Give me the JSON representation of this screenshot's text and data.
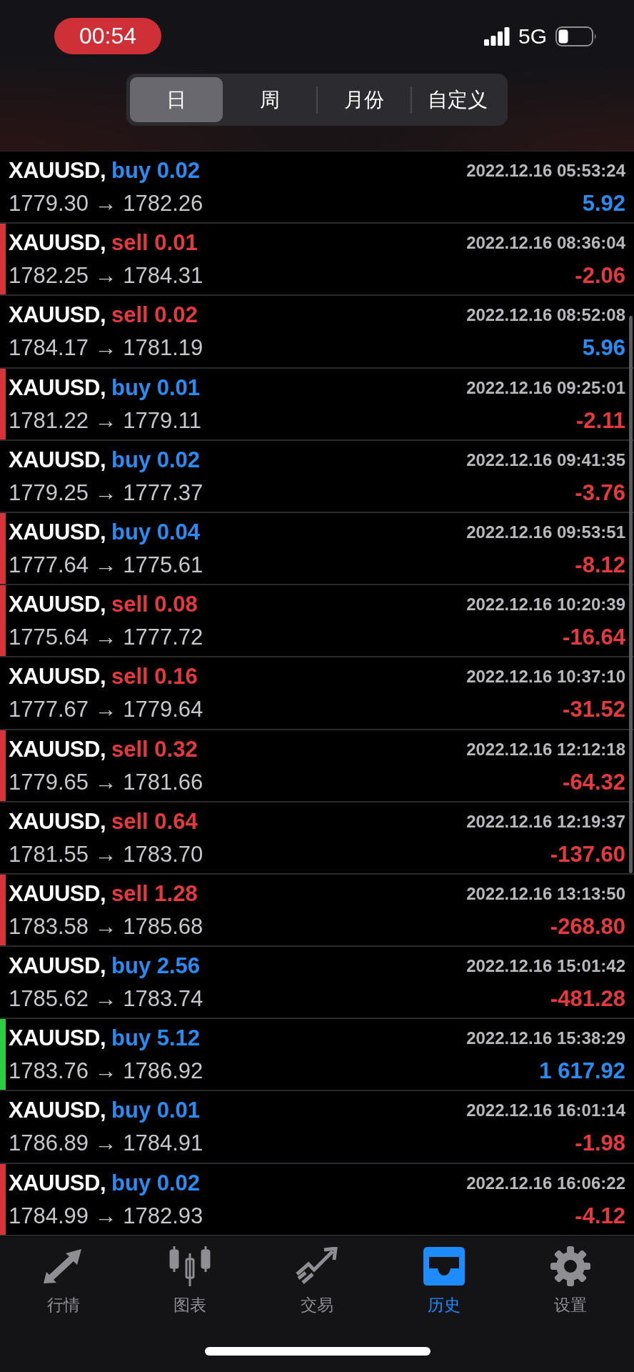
{
  "status_bar": {
    "time": "00:54",
    "network": "5G"
  },
  "period_tabs": [
    {
      "label": "日",
      "selected": true
    },
    {
      "label": "周",
      "selected": false
    },
    {
      "label": "月份",
      "selected": false
    },
    {
      "label": "自定义",
      "selected": false
    }
  ],
  "deals": [
    {
      "symbol": "XAUUSD,",
      "order": "buy 0.02",
      "kind": "buy",
      "time": "2022.12.16 05:53:24",
      "prices": "1779.30 → 1782.26",
      "profit": "5.92",
      "loss": false
    },
    {
      "symbol": "XAUUSD,",
      "order": "sell 0.01",
      "kind": "sell",
      "time": "2022.12.16 08:36:04",
      "prices": "1782.25 → 1784.31",
      "profit": "-2.06",
      "loss": true,
      "color": "#d8333a"
    },
    {
      "symbol": "XAUUSD,",
      "order": "sell 0.02",
      "kind": "sell",
      "time": "2022.12.16 08:52:08",
      "prices": "1784.17 → 1781.19",
      "profit": "5.96",
      "loss": false
    },
    {
      "symbol": "XAUUSD,",
      "order": "buy 0.01",
      "kind": "buy",
      "time": "2022.12.16 09:25:01",
      "prices": "1781.22 → 1779.11",
      "profit": "-2.11",
      "loss": true,
      "color": "#d8333a"
    },
    {
      "symbol": "XAUUSD,",
      "order": "buy 0.02",
      "kind": "buy",
      "time": "2022.12.16 09:41:35",
      "prices": "1779.25 → 1777.37",
      "profit": "-3.76",
      "loss": true
    },
    {
      "symbol": "XAUUSD,",
      "order": "buy 0.04",
      "kind": "buy",
      "time": "2022.12.16 09:53:51",
      "prices": "1777.64 → 1775.61",
      "profit": "-8.12",
      "loss": true,
      "color": "#d8333a"
    },
    {
      "symbol": "XAUUSD,",
      "order": "sell 0.08",
      "kind": "sell",
      "time": "2022.12.16 10:20:39",
      "prices": "1775.64 → 1777.72",
      "profit": "-16.64",
      "loss": true,
      "color": "#d8333a"
    },
    {
      "symbol": "XAUUSD,",
      "order": "sell 0.16",
      "kind": "sell",
      "time": "2022.12.16 10:37:10",
      "prices": "1777.67 → 1779.64",
      "profit": "-31.52",
      "loss": true
    },
    {
      "symbol": "XAUUSD,",
      "order": "sell 0.32",
      "kind": "sell",
      "time": "2022.12.16 12:12:18",
      "prices": "1779.65 → 1781.66",
      "profit": "-64.32",
      "loss": true,
      "color": "#d8333a"
    },
    {
      "symbol": "XAUUSD,",
      "order": "sell 0.64",
      "kind": "sell",
      "time": "2022.12.16 12:19:37",
      "prices": "1781.55 → 1783.70",
      "profit": "-137.60",
      "loss": true
    },
    {
      "symbol": "XAUUSD,",
      "order": "sell 1.28",
      "kind": "sell",
      "time": "2022.12.16 13:13:50",
      "prices": "1783.58 → 1785.68",
      "profit": "-268.80",
      "loss": true,
      "color": "#d8333a"
    },
    {
      "symbol": "XAUUSD,",
      "order": "buy 2.56",
      "kind": "buy",
      "time": "2022.12.16 15:01:42",
      "prices": "1785.62 → 1783.74",
      "profit": "-481.28",
      "loss": true
    },
    {
      "symbol": "XAUUSD,",
      "order": "buy 5.12",
      "kind": "buy",
      "time": "2022.12.16 15:38:29",
      "prices": "1783.76 → 1786.92",
      "profit": "1 617.92",
      "loss": false,
      "color": "#2ecc40"
    },
    {
      "symbol": "XAUUSD,",
      "order": "buy 0.01",
      "kind": "buy",
      "time": "2022.12.16 16:01:14",
      "prices": "1786.89 → 1784.91",
      "profit": "-1.98",
      "loss": true
    },
    {
      "symbol": "XAUUSD,",
      "order": "buy 0.02",
      "kind": "buy",
      "time": "2022.12.16 16:06:22",
      "prices": "1784.99 → 1782.93",
      "profit": "-4.12",
      "loss": true,
      "color": "#d8333a"
    }
  ],
  "bottom_nav": [
    {
      "label": "行情",
      "selected": false
    },
    {
      "label": "图表",
      "selected": false
    },
    {
      "label": "交易",
      "selected": false
    },
    {
      "label": "历史",
      "selected": true
    },
    {
      "label": "设置",
      "selected": false
    }
  ]
}
